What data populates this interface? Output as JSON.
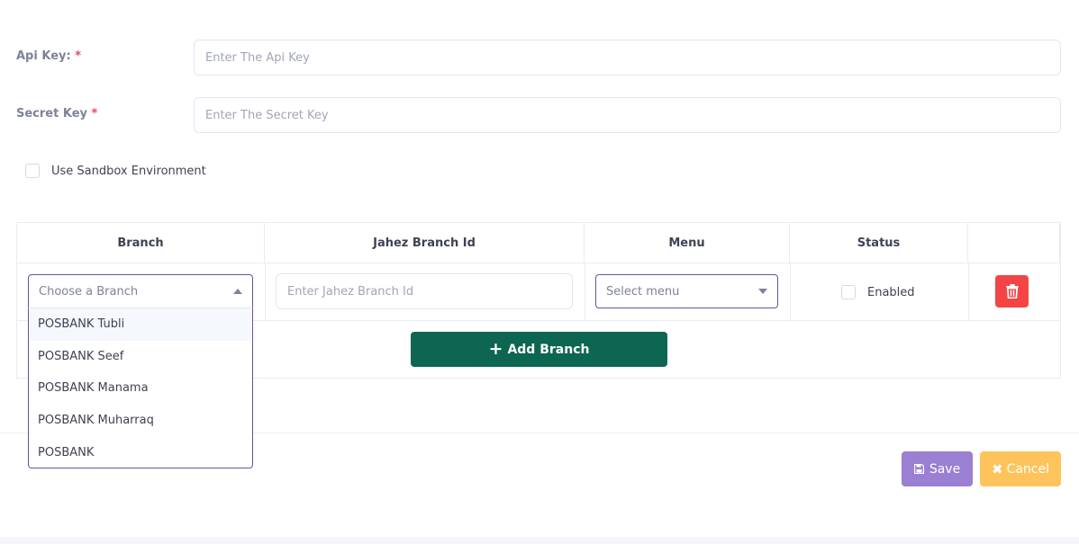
{
  "form": {
    "api_key": {
      "label": "Api Key:",
      "required_mark": "*",
      "value": "",
      "placeholder": "Enter The Api Key"
    },
    "secret_key": {
      "label": "Secret Key",
      "required_mark": "*",
      "value": "",
      "placeholder": "Enter The Secret Key"
    },
    "sandbox": {
      "label": "Use Sandbox Environment",
      "checked": false
    }
  },
  "branch_table": {
    "headers": [
      "Branch",
      "Jahez Branch Id",
      "Menu",
      "Status",
      ""
    ],
    "row": {
      "branch_select": {
        "placeholder": "Choose a Branch",
        "open": true
      },
      "branch_id": {
        "value": "",
        "placeholder": "Enter Jahez Branch Id"
      },
      "menu_select": {
        "placeholder": "Select menu"
      },
      "status": {
        "label": "Enabled",
        "checked": false
      },
      "delete_icon": "trash-icon"
    },
    "add_button_label": "Add Branch",
    "add_icon": "plus-icon"
  },
  "branch_options": [
    "POSBANK Tubli",
    "POSBANK Seef",
    "POSBANK Manama",
    "POSBANK Muharraq",
    "POSBANK"
  ],
  "highlighted_option_index": 0,
  "footer": {
    "save_label": "Save",
    "save_icon": "floppy-disk-icon",
    "cancel_label": "Cancel",
    "cancel_icon": "x-icon"
  },
  "colors": {
    "primary_green": "#0c6651",
    "save_purple": "#9b7fd3",
    "cancel_orange": "#ffc35c",
    "danger_red": "#f44546",
    "focus_border": "#6a51a6",
    "required": "#f1416c"
  }
}
